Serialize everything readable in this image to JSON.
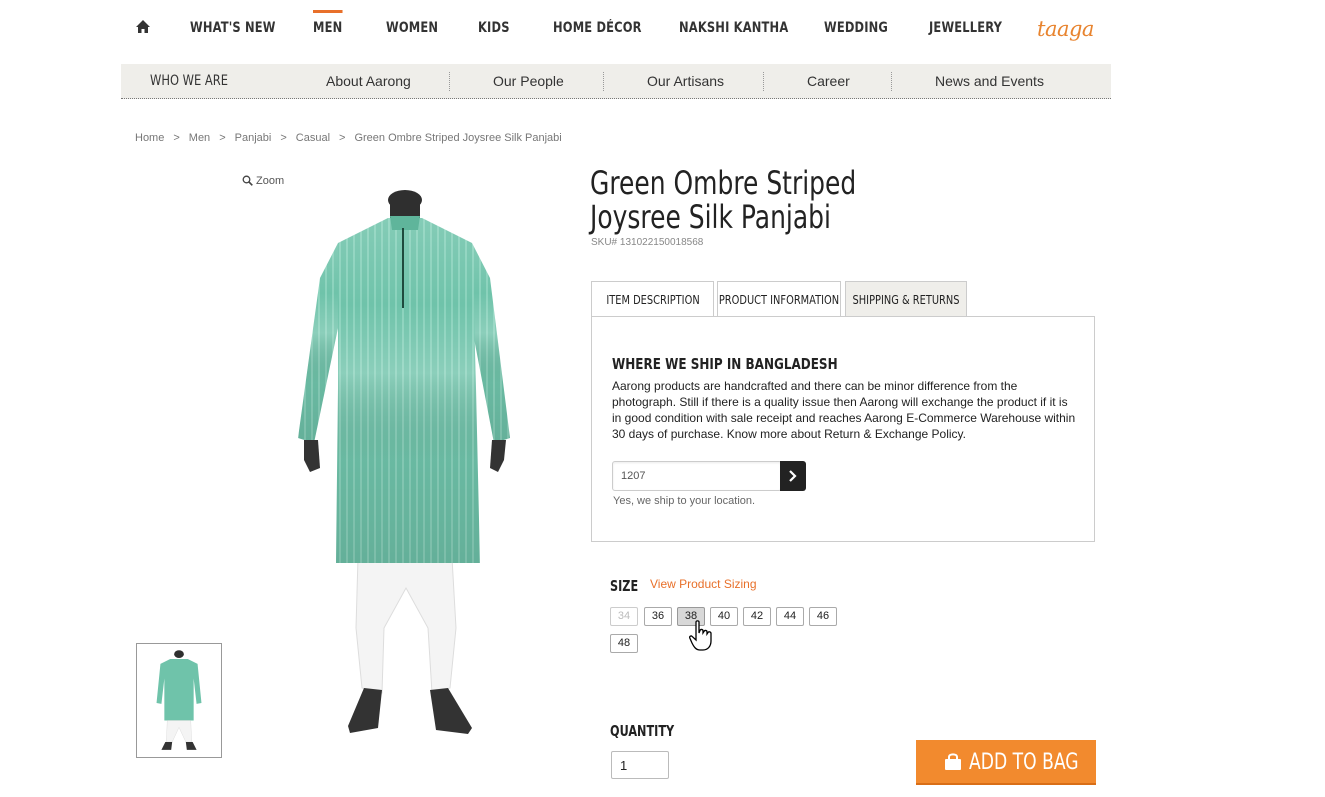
{
  "nav": {
    "items": [
      {
        "label": "WHAT'S NEW"
      },
      {
        "label": "MEN"
      },
      {
        "label": "WOMEN"
      },
      {
        "label": "KIDS"
      },
      {
        "label": "HOME DÉCOR"
      },
      {
        "label": "NAKSHI KANTHA"
      },
      {
        "label": "WEDDING"
      },
      {
        "label": "JEWELLERY"
      }
    ],
    "active": "MEN",
    "brand_link": "taaga",
    "accent_color": "#e8702a"
  },
  "subnav": {
    "title": "WHO WE ARE",
    "items": [
      {
        "label": "About Aarong"
      },
      {
        "label": "Our People"
      },
      {
        "label": "Our Artisans"
      },
      {
        "label": "Career"
      },
      {
        "label": "News and Events"
      }
    ]
  },
  "breadcrumb": {
    "items": [
      "Home",
      "Men",
      "Panjabi",
      "Casual",
      "Green Ombre Striped Joysree Silk Panjabi"
    ],
    "separator": ">"
  },
  "gallery": {
    "zoom_label": "Zoom"
  },
  "product": {
    "title_line1": "Green Ombre Striped",
    "title_line2": "Joysree Silk Panjabi",
    "sku": "SKU# 131022150018568",
    "garment_color": "#6fc3aa"
  },
  "tabs": {
    "items": [
      {
        "label": "ITEM DESCRIPTION"
      },
      {
        "label": "PRODUCT INFORMATION"
      },
      {
        "label": "SHIPPING & RETURNS"
      }
    ],
    "active": "SHIPPING & RETURNS"
  },
  "shipping": {
    "heading": "WHERE WE SHIP IN BANGLADESH",
    "text": "Aarong products are handcrafted and there can be minor difference from the photograph. Still if there is a quality issue then Aarong will exchange the product if it is in good condition with sale receipt and reaches Aarong E-Commerce Warehouse within 30 days of purchase. Know more about Return & Exchange Policy.",
    "zip_value": "1207",
    "message": "Yes, we ship to your location."
  },
  "size": {
    "label": "SIZE",
    "link": "View Product Sizing",
    "options": [
      {
        "label": "34",
        "state": "disabled"
      },
      {
        "label": "36",
        "state": "available"
      },
      {
        "label": "38",
        "state": "selected"
      },
      {
        "label": "40",
        "state": "available"
      },
      {
        "label": "42",
        "state": "available"
      },
      {
        "label": "44",
        "state": "available"
      },
      {
        "label": "46",
        "state": "available"
      },
      {
        "label": "48",
        "state": "available"
      }
    ]
  },
  "quantity": {
    "label": "QUANTITY",
    "value": "1"
  },
  "cart": {
    "add_label": "ADD TO BAG",
    "button_color": "#f28a2e"
  }
}
